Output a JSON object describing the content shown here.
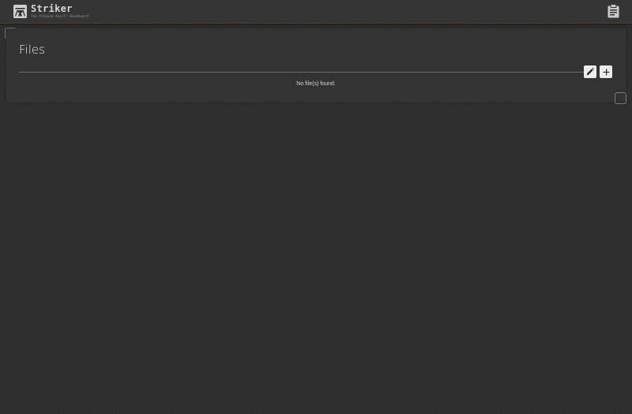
{
  "header": {
    "app_name": "Striker",
    "app_subtitle": "The Alteeve Anvil! Dashboard",
    "logo_icon": "anvil-logo-icon",
    "clipboard_icon": "clipboard-icon"
  },
  "files_panel": {
    "title": "Files",
    "edit_icon": "pencil-icon",
    "add_icon": "plus-icon",
    "empty_message": "No file(s) found."
  },
  "colors": {
    "background": "#2f2f2f",
    "panel": "#333333",
    "header_border": "#5a3a36"
  }
}
